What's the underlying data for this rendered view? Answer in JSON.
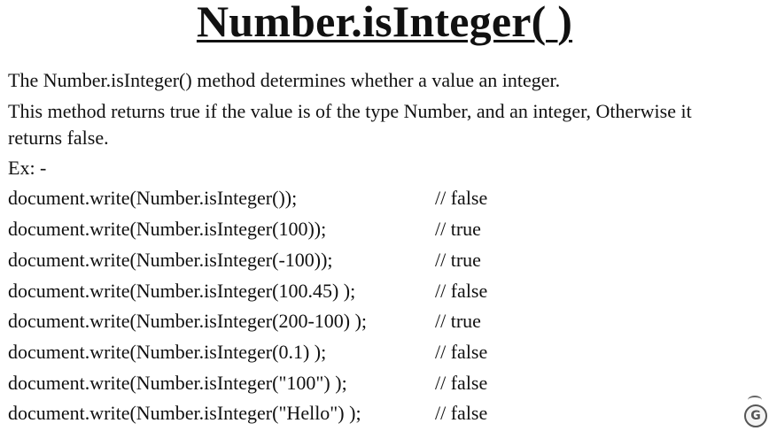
{
  "slide": {
    "title": "Number.isInteger( )",
    "description_line1": "The Number.isInteger() method determines whether a value an integer.",
    "description_line2": "This method returns true if the value is of the type Number, and an integer, Otherwise it",
    "description_line3": "returns false.",
    "example_label": "Ex: -"
  },
  "examples": [
    {
      "code": "document.write(Number.isInteger());",
      "result": "// false"
    },
    {
      "code": "document.write(Number.isInteger(100));",
      "result": "// true"
    },
    {
      "code": "document.write(Number.isInteger(-100));",
      "result": "// true"
    },
    {
      "code": "document.write(Number.isInteger(100.45) );",
      "result": "// false"
    },
    {
      "code": "document.write(Number.isInteger(200-100) );",
      "result": "// true"
    },
    {
      "code": "document.write(Number.isInteger(0.1) );",
      "result": "// false"
    },
    {
      "code": "document.write(Number.isInteger(\"100\") );",
      "result": "// false"
    },
    {
      "code": "document.write(Number.isInteger(\"Hello\") );",
      "result": "// false"
    }
  ],
  "watermark": {
    "icon": "channel-logo-icon",
    "glyph": "G"
  }
}
